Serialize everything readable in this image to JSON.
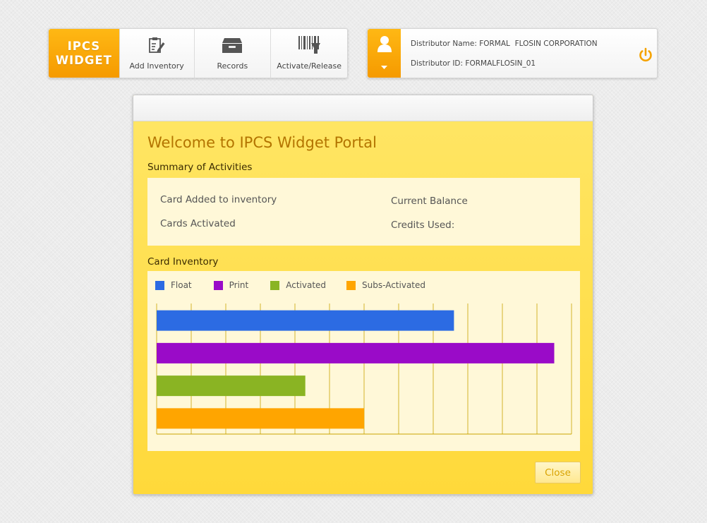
{
  "header": {
    "logo_line1": "IPCS",
    "logo_line2": "WIDGET",
    "nav": [
      {
        "label": "Add Inventory",
        "icon": "add-inventory-icon"
      },
      {
        "label": "Records",
        "icon": "records-icon"
      },
      {
        "label": "Activate/Release",
        "icon": "barcode-scanner-icon"
      }
    ]
  },
  "user": {
    "distributor_name_label": "Distributor Name:",
    "distributor_name": "FORMAL  FLOSIN CORPORATION",
    "distributor_id_label": "Distributor ID:",
    "distributor_id": "FORMALFLOSIN_01",
    "avatar_icon": "user-icon",
    "power_icon": "power-icon"
  },
  "modal": {
    "welcome_title": "Welcome to IPCS Widget Portal",
    "summary_title": "Summary of Activities",
    "summary_labels": {
      "cards_added": "Card Added to inventory",
      "cards_activated": "Cards Activated",
      "current_balance": "Current Balance",
      "credits_used": "Credits Used:"
    },
    "inventory_title": "Card Inventory",
    "close_label": "Close"
  },
  "colors": {
    "accent": "#f5a300",
    "modal_bg": "#ffdf45",
    "panel_bg": "#fff8d8",
    "grid": "#c8a400"
  },
  "chart_data": {
    "type": "bar",
    "orientation": "horizontal",
    "categories": [
      "Float",
      "Print",
      "Activated",
      "Subs-Activated"
    ],
    "series": [
      {
        "name": "Float",
        "value": 43,
        "color": "#2c6be3"
      },
      {
        "name": "Print",
        "value": 57.5,
        "color": "#9a0bc8"
      },
      {
        "name": "Activated",
        "value": 21.5,
        "color": "#8ab423"
      },
      {
        "name": "Subs-Activated",
        "value": 30,
        "color": "#ffa500"
      }
    ],
    "xlim": [
      0,
      60
    ],
    "grid_step": 5,
    "grid": true,
    "legend": "top-left"
  }
}
